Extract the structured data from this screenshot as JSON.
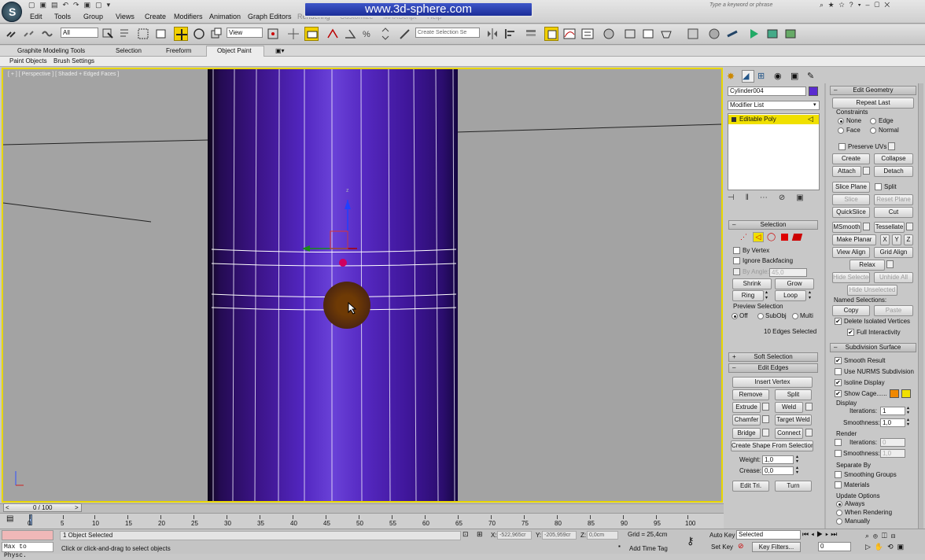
{
  "watermark": "www.3d-sphere.com",
  "search_placeholder": "Type a keyword or phrase",
  "menus": [
    "Edit",
    "Tools",
    "Group",
    "Views",
    "Create",
    "Modifiers",
    "Animation",
    "Graph Editors",
    "Rendering",
    "Customize",
    "MAXScript",
    "Help"
  ],
  "toolbar": {
    "filter": "All",
    "view": "View",
    "named_sel": "Create Selection Se"
  },
  "ribbon_tabs": [
    "Graphite Modeling Tools",
    "Selection",
    "Freeform",
    "Object Paint"
  ],
  "ribbon_sub": [
    "Paint Objects",
    "Brush Settings"
  ],
  "viewport_label": "[ + ] [ Perspective ] [ Shaded + Edged Faces ]",
  "axis": {
    "z": "z",
    "x": "x"
  },
  "panel": {
    "object_name": "Cylinder004",
    "modifier_list": "Modifier List",
    "stack_item": "Editable Poly",
    "selection": {
      "title": "Selection",
      "by_vertex": "By Vertex",
      "ignore_backfacing": "Ignore Backfacing",
      "by_angle": "By Angle:",
      "angle": "45,0",
      "shrink": "Shrink",
      "grow": "Grow",
      "ring": "Ring",
      "loop": "Loop",
      "preview": "Preview Selection",
      "off": "Off",
      "subobj": "SubObj",
      "multi": "Multi",
      "status": "10 Edges Selected"
    },
    "soft_selection": "Soft Selection",
    "edit_edges": {
      "title": "Edit Edges",
      "insert_vertex": "Insert Vertex",
      "remove": "Remove",
      "split": "Split",
      "extrude": "Extrude",
      "weld": "Weld",
      "chamfer": "Chamfer",
      "target_weld": "Target Weld",
      "bridge": "Bridge",
      "connect": "Connect",
      "create_shape": "Create Shape From Selection",
      "weight_label": "Weight:",
      "weight": "1,0",
      "crease_label": "Crease:",
      "crease": "0,0",
      "edit_tri": "Edit Tri.",
      "turn": "Turn"
    },
    "edit_geometry": {
      "title": "Edit Geometry",
      "repeat_last": "Repeat Last",
      "constraints": "Constraints",
      "none": "None",
      "edge": "Edge",
      "face": "Face",
      "normal": "Normal",
      "preserve_uvs": "Preserve UVs",
      "create": "Create",
      "collapse": "Collapse",
      "attach": "Attach",
      "detach": "Detach",
      "slice_plane": "Slice Plane",
      "split": "Split",
      "slice": "Slice",
      "reset_plane": "Reset Plane",
      "quickslice": "QuickSlice",
      "cut": "Cut",
      "msmooth": "MSmooth",
      "tessellate": "Tessellate",
      "make_planar": "Make Planar",
      "x": "X",
      "y": "Y",
      "z": "Z",
      "view_align": "View Align",
      "grid_align": "Grid Align",
      "relax": "Relax",
      "hide_selected": "Hide Selected",
      "unhide_all": "Unhide All",
      "hide_unselected": "Hide Unselected",
      "named_selections": "Named Selections:",
      "copy": "Copy",
      "paste": "Paste",
      "delete_isolated": "Delete Isolated Vertices",
      "full_interactivity": "Full Interactivity"
    },
    "subdivision": {
      "title": "Subdivision Surface",
      "smooth_result": "Smooth Result",
      "use_nurms": "Use NURMS Subdivision",
      "isoline": "Isoline Display",
      "show_cage": "Show Cage......",
      "display": "Display",
      "iterations_label": "Iterations:",
      "iterations": "1",
      "smoothness_label": "Smoothness:",
      "smoothness": "1,0",
      "render": "Render",
      "r_iterations": "0",
      "r_smoothness": "1,0",
      "separate_by": "Separate By",
      "smoothing_groups": "Smoothing Groups",
      "materials": "Materials",
      "update_options": "Update Options",
      "always": "Always",
      "when_rendering": "When Rendering",
      "manually": "Manually"
    }
  },
  "timeline": {
    "frame": "0 / 100",
    "ticks": [
      "0",
      "5",
      "10",
      "15",
      "20",
      "25",
      "30",
      "35",
      "40",
      "45",
      "50",
      "55",
      "60",
      "65",
      "70",
      "75",
      "80",
      "85",
      "90",
      "95",
      "100"
    ]
  },
  "status": {
    "script": "Max to Physc.",
    "selected": "1 Object Selected",
    "prompt": "Click or click-and-drag to select objects",
    "x_label": "X:",
    "x": "-522,965cr",
    "y_label": "Y:",
    "y": "-205,959cr",
    "z_label": "Z:",
    "z": "0,0cm",
    "grid": "Grid = 25,4cm",
    "add_time_tag": "Add Time Tag",
    "auto_key": "Auto Key",
    "set_key": "Set Key",
    "key_mode": "Selected",
    "key_filters": "Key Filters...",
    "frame": "0"
  },
  "colors": {
    "object": "#5a2bb5",
    "accent": "#f0e000",
    "swatch": "#5a2bd0",
    "cage1": "#f08800",
    "cage2": "#f0e000"
  }
}
